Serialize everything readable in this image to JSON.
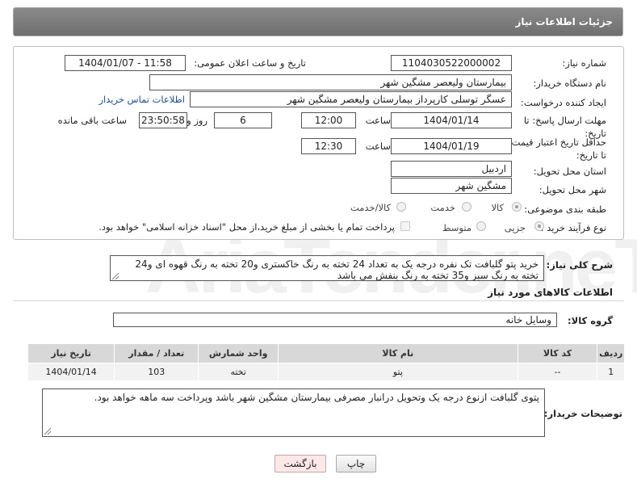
{
  "header": {
    "title": "جزئیات اطلاعات نیاز"
  },
  "fields": {
    "need_number_label": "شماره نیاز:",
    "need_number": "1104030522000002",
    "announce_label": "تاریخ و ساعت اعلان عمومی:",
    "announce_value": "1404/01/07 - 11:58",
    "buyer_org_label": "نام دستگاه خریدار:",
    "buyer_org": "بیمارستان ولیعصر مشگین شهر",
    "requester_label": "ایجاد کننده درخواست:",
    "requester": "عسگر توسلی کارپرداز بیمارستان ولیعصر مشگین شهر",
    "contact_link": "اطلاعات تماس خریدار",
    "reply_deadline_label": "مهلت ارسال پاسخ: تا تاریخ:",
    "reply_date": "1404/01/14",
    "time_label": "ساعت",
    "reply_time": "12:00",
    "days_value": "6",
    "days_label": "روز و",
    "remaining_time": "23:50:58",
    "remaining_label": "ساعت باقی مانده",
    "price_validity_label": "حداقل تاریخ اعتبار قیمت: تا تاریخ:",
    "validity_date": "1404/01/19",
    "validity_time": "12:30",
    "province_label": "استان محل تحویل:",
    "province": "اردبیل",
    "city_label": "شهر محل تحویل:",
    "city": "مشگین شهر",
    "category_label": "طبقه بندی موضوعی:",
    "category_options": [
      "کالا",
      "خدمت",
      "کالا/خدمت"
    ],
    "process_label": "نوع فرآیند خرید :",
    "process_options": [
      "جزیی",
      "متوسط"
    ],
    "payment_note": "پرداخت تمام یا بخشی از مبلغ خرید،از محل \"اسناد خزانه اسلامی\" خواهد بود."
  },
  "description": {
    "label": "شرح کلی نیاز:",
    "text": "خرید پتو گلبافت تک نفره درجه یک به تعداد 24 تخته به رنگ خاکستری و20 تخته به رنگ قهوه ای و24 تخته به رنگ سبز و35 تخته به رنگ بنفش می باشد"
  },
  "goods": {
    "section_title": "اطلاعات کالاهای مورد نیاز",
    "group_label": "گروه کالا:",
    "group_value": "وسایل خانه",
    "columns": [
      "ردیف",
      "کد کالا",
      "نام کالا",
      "واحد شمارش",
      "تعداد / مقدار",
      "تاریخ نیاز"
    ],
    "rows": [
      [
        "1",
        "--",
        "پتو",
        "تخته",
        "103",
        "1404/01/14"
      ]
    ]
  },
  "buyer_notes": {
    "label": "توضیحات خریدار:",
    "text": "پتوی گلبافت ازنوع درجه یک وتحویل درانبار مصرفی بیمارستان مشگین شهر باشد وپرداخت سه ماهه خواهد بود."
  },
  "buttons": {
    "print": "چاپ",
    "back": "بازگشت"
  },
  "watermark": "AriaTender.neT",
  "colors": {
    "header_bg": "#7a7a7a",
    "link": "#1a4fa0",
    "back_button_bg": "#fde8e8"
  }
}
